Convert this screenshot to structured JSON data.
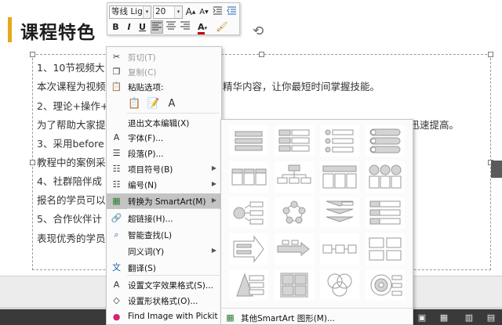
{
  "slide": {
    "title": "课程特色",
    "lines": [
      "1、10节视频大",
      "本次课程为视频",
      "精华内容，让你最短时间掌握技能。",
      "2、理论+操作+",
      "为了帮助大家提",
      "且有手把手操作，还有课后作业点评，让你迅速提高。",
      "3、采用before a",
      "教程中的案例采",
      "4、社群陪伴成",
      "报名的学员可以",
      "5、合作伙伴计",
      "表现优秀的学员"
    ]
  },
  "mini_toolbar": {
    "font_name": "等线 Ligh",
    "font_size": "20",
    "grow_font": "A",
    "shrink_font": "A",
    "bold": "B",
    "italic": "I",
    "underline": "U",
    "font_color": "A"
  },
  "context_menu": {
    "items": [
      {
        "label": "剪切(T)",
        "icon": "scissors-icon",
        "glyph": "✂",
        "disabled": true
      },
      {
        "label": "复制(C)",
        "icon": "copy-icon",
        "glyph": "❐",
        "disabled": true
      },
      {
        "label": "粘贴选项:",
        "icon": "paste-icon",
        "glyph": "📋",
        "disabled": false
      },
      {
        "label": "退出文本编辑(X)",
        "icon": "",
        "glyph": "",
        "disabled": false
      },
      {
        "label": "字体(F)...",
        "icon": "font-icon",
        "glyph": "A",
        "disabled": false
      },
      {
        "label": "段落(P)...",
        "icon": "paragraph-icon",
        "glyph": "☰",
        "disabled": false
      },
      {
        "label": "项目符号(B)",
        "icon": "bullets-icon",
        "glyph": "☷",
        "disabled": false
      },
      {
        "label": "编号(N)",
        "icon": "numbering-icon",
        "glyph": "☷",
        "disabled": false
      },
      {
        "label": "转换为 SmartArt(M)",
        "icon": "smartart-icon",
        "glyph": "▦",
        "disabled": false
      },
      {
        "label": "超链接(H)...",
        "icon": "hyperlink-icon",
        "glyph": "🔗",
        "disabled": false
      },
      {
        "label": "智能查找(L)",
        "icon": "smart-lookup-icon",
        "glyph": "⌕",
        "disabled": false
      },
      {
        "label": "同义词(Y)",
        "icon": "",
        "glyph": "",
        "disabled": false
      },
      {
        "label": "翻译(S)",
        "icon": "translate-icon",
        "glyph": "文",
        "disabled": false
      },
      {
        "label": "设置文字效果格式(S)...",
        "icon": "text-effects-icon",
        "glyph": "A",
        "disabled": false
      },
      {
        "label": "设置形状格式(O)...",
        "icon": "shape-format-icon",
        "glyph": "◇",
        "disabled": false
      },
      {
        "label": "Find Image with Pickit",
        "icon": "pickit-icon",
        "glyph": "●",
        "disabled": false
      }
    ]
  },
  "smartart": {
    "more_label": "其他SmartArt 图形(M)..."
  }
}
